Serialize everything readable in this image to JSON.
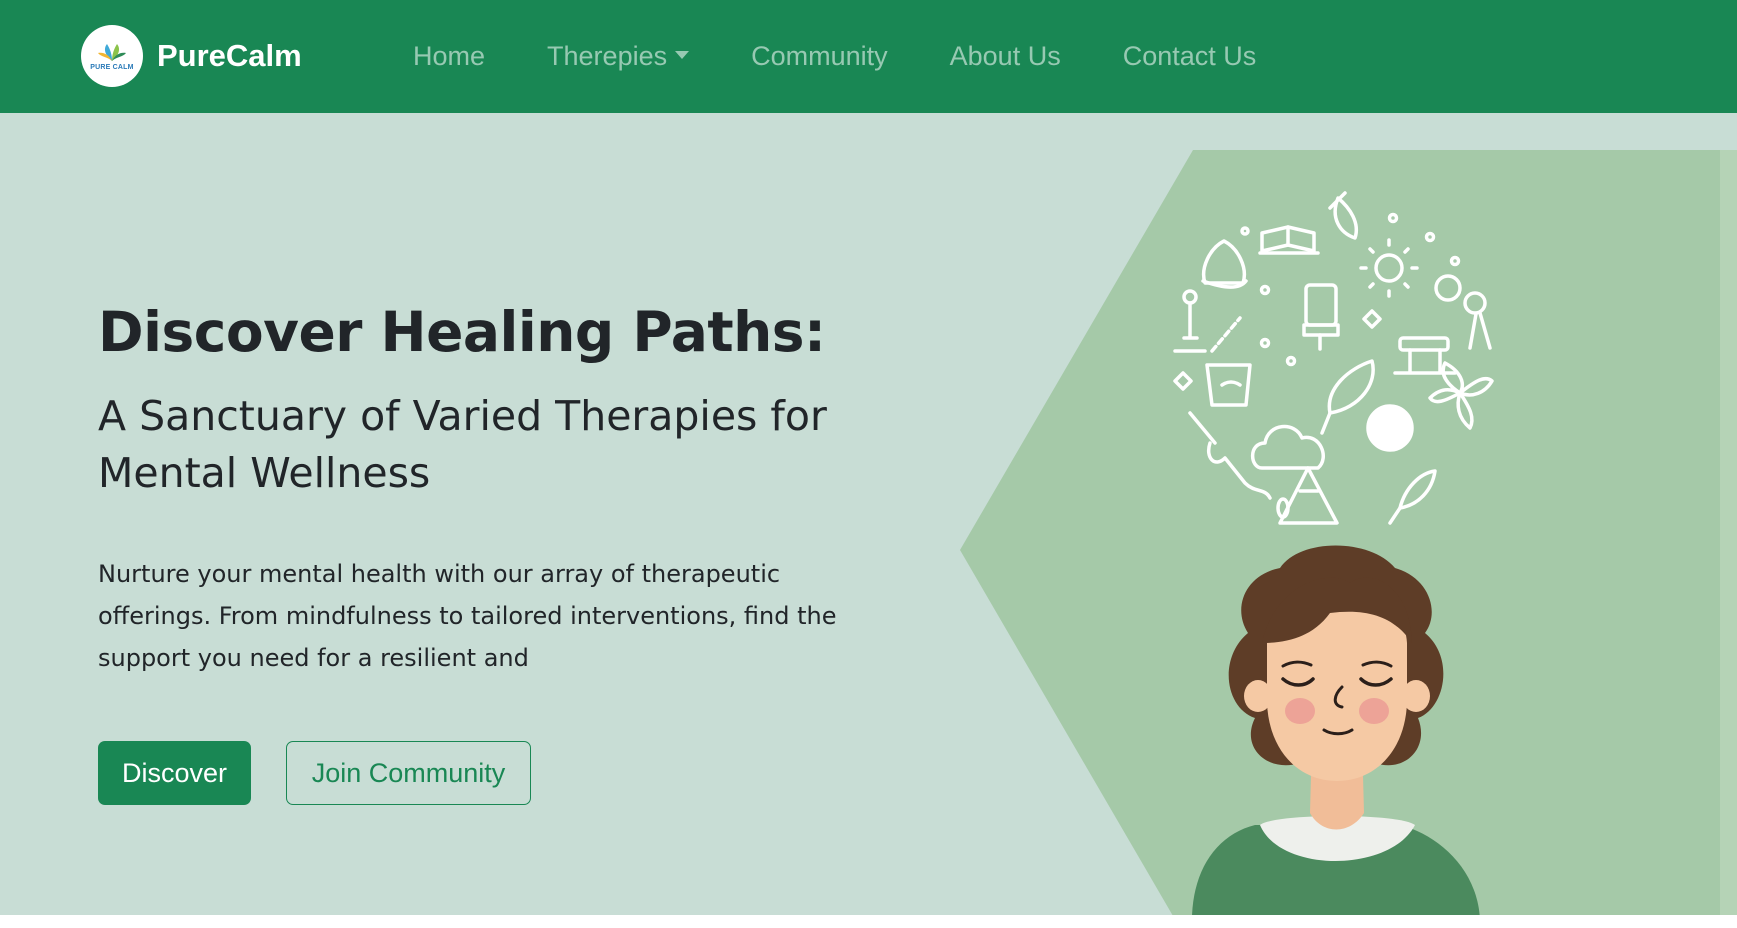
{
  "nav": {
    "brand_name": "PureCalm",
    "logo_text": "PURE CALM",
    "links": [
      {
        "label": "Home"
      },
      {
        "label": "Therepies",
        "has_dropdown": true
      },
      {
        "label": "Community"
      },
      {
        "label": "About Us"
      },
      {
        "label": "Contact Us"
      }
    ]
  },
  "hero": {
    "title": "Discover Healing Paths:",
    "subtitle": "A Sanctuary of Varied Therapies for Mental Wellness",
    "description": "Nurture your mental health with our array of therapeutic offerings. From mindfulness to tailored interventions, find the support you need for a resilient and",
    "primary_button": "Discover",
    "secondary_button": "Join Community"
  },
  "colors": {
    "brand_green": "#198754",
    "hero_bg": "#c8ddd5",
    "panel_green": "#a5c9a8",
    "hair_brown": "#5e3d27",
    "skin": "#f5c9a4",
    "shirt_green": "#4b8a5e"
  },
  "illustration": {
    "icons": [
      "lotus-icon",
      "book-icon",
      "leaf-icon",
      "sun-icon",
      "chair-icon",
      "candle-icon",
      "massage-table-icon",
      "brush-icon",
      "cloud-icon",
      "yoga-ball-icon",
      "mountain-icon",
      "plant-icon"
    ]
  }
}
